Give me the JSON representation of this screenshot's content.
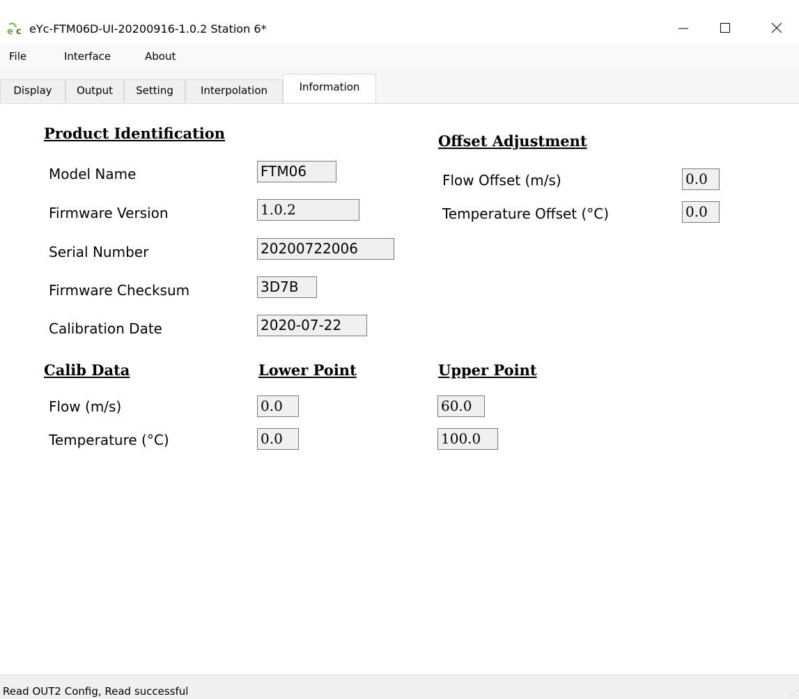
{
  "window": {
    "title": "eYc-FTM06D-UI-20200916-1.0.2  Station 6*",
    "icon": "eyc-app-icon"
  },
  "menu": [
    {
      "label": "File"
    },
    {
      "label": "Interface"
    },
    {
      "label": "About"
    }
  ],
  "tabs": [
    {
      "label": "Display",
      "active": false
    },
    {
      "label": "Output",
      "active": false
    },
    {
      "label": "Setting",
      "active": false
    },
    {
      "label": "Interpolation",
      "active": false
    },
    {
      "label": "Information",
      "active": true
    }
  ],
  "product_identification": {
    "heading": "Product Identification",
    "model_name": {
      "label": "Model Name",
      "value": "FTM06"
    },
    "firmware_version": {
      "label": "Firmware Version",
      "value": "1.0.2"
    },
    "serial_number": {
      "label": "Serial Number",
      "value": "20200722006"
    },
    "firmware_checksum": {
      "label": "Firmware Checksum",
      "value": "3D7B"
    },
    "calibration_date": {
      "label": "Calibration Date",
      "value": "2020-07-22"
    }
  },
  "offset_adjustment": {
    "heading": "Offset Adjustment",
    "flow_offset": {
      "label": "Flow Offset (m/s)",
      "value": "0.0"
    },
    "temperature_offset": {
      "label": "Temperature Offset (°C)",
      "value": "0.0"
    }
  },
  "calib_data": {
    "heading": "Calib Data",
    "lower_heading": "Lower Point",
    "upper_heading": "Upper Point",
    "flow": {
      "label": "Flow (m/s)",
      "lower": "0.0",
      "upper": "60.0"
    },
    "temperature": {
      "label": "Temperature (°C)",
      "lower": "0.0",
      "upper": "100.0"
    }
  },
  "status": {
    "text": "Read OUT2 Config,   Read successful"
  },
  "colors": {
    "icon_green": "#6bb43f",
    "tab_border": "#d9d9d9",
    "value_box_bg": "#f0f0f0"
  }
}
